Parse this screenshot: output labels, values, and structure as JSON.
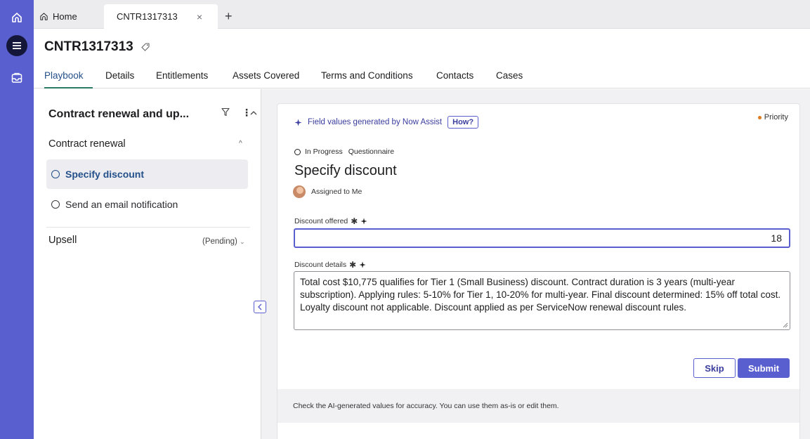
{
  "colors": {
    "rail": "#5a5fd0",
    "accent": "#5a5fd0",
    "active_tab_text": "#24508a",
    "tab_underline": "#2b7c64",
    "priority_dot": "#e07a1f"
  },
  "rail": {
    "icons": [
      "home-icon",
      "list-icon",
      "inbox-icon"
    ]
  },
  "tabs": {
    "home_label": "Home",
    "active_label": "CNTR1317313",
    "close_glyph": "×",
    "add_glyph": "+"
  },
  "record": {
    "title": "CNTR1317313",
    "tabs": [
      "Playbook",
      "Details",
      "Entitlements",
      "Assets Covered",
      "Terms and Conditions",
      "Contacts",
      "Cases"
    ]
  },
  "playbook": {
    "title": "Contract renewal and up...",
    "sections": [
      {
        "label": "Contract renewal",
        "items": [
          {
            "label": "Specify discount",
            "selected": true
          },
          {
            "label": "Send an email notification",
            "selected": false
          }
        ]
      },
      {
        "label": "Upsell",
        "status": "(Pending)"
      }
    ]
  },
  "task": {
    "ai_banner": "Field values generated by Now Assist",
    "how_label": "How?",
    "priority_label": "Priority",
    "state": "In Progress",
    "type": "Questionnaire",
    "title": "Specify discount",
    "assigned": "Assigned to Me",
    "discount_offered_label": "Discount offered",
    "discount_offered_value": "18",
    "discount_details_label": "Discount details",
    "discount_details_value": "Total cost $10,775 qualifies for Tier 1 (Small Business) discount. Contract duration is 3 years (multi-year subscription). Applying rules: 5-10% for Tier 1, 10-20% for multi-year. Final discount determined: 15% off total cost. Loyalty discount not applicable. Discount applied as per ServiceNow renewal discount rules.",
    "skip_label": "Skip",
    "submit_label": "Submit",
    "footer_note": "Check the AI-generated values for accuracy. You can use them as-is or edit them."
  }
}
